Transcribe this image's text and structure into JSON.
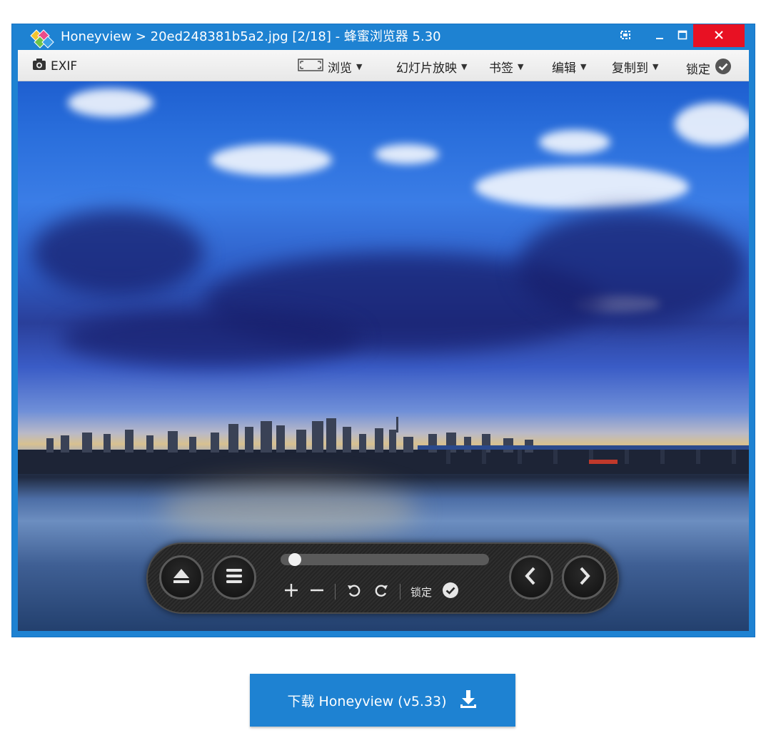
{
  "window": {
    "title": "Honeyview > 20ed248381b5a2.jpg [2/18] - 蜂蜜浏览器 5.30",
    "accent_color": "#1e82d2",
    "close_color": "#e81123",
    "controls": [
      "screen-capture-icon",
      "minimize-icon",
      "maximize-icon",
      "close-icon"
    ]
  },
  "menubar": {
    "exif_label": "EXIF",
    "items": [
      {
        "label": "浏览",
        "icon": "fullscreen-frame-icon"
      },
      {
        "label": "幻灯片放映"
      },
      {
        "label": "书签"
      },
      {
        "label": "编辑"
      },
      {
        "label": "复制到"
      },
      {
        "label": "锁定",
        "icon": "check-circle-icon"
      }
    ]
  },
  "controller": {
    "buttons_left": [
      "eject-icon",
      "menu-icon"
    ],
    "buttons_right": [
      "prev-icon",
      "next-icon"
    ],
    "tools": [
      "zoom-in-icon",
      "zoom-out-icon",
      "rotate-left-icon",
      "rotate-right-icon"
    ],
    "lock_label": "锁定",
    "seek_progress": 0.04
  },
  "download": {
    "label": "下载 Honeyview (v5.33)",
    "icon": "download-icon"
  }
}
